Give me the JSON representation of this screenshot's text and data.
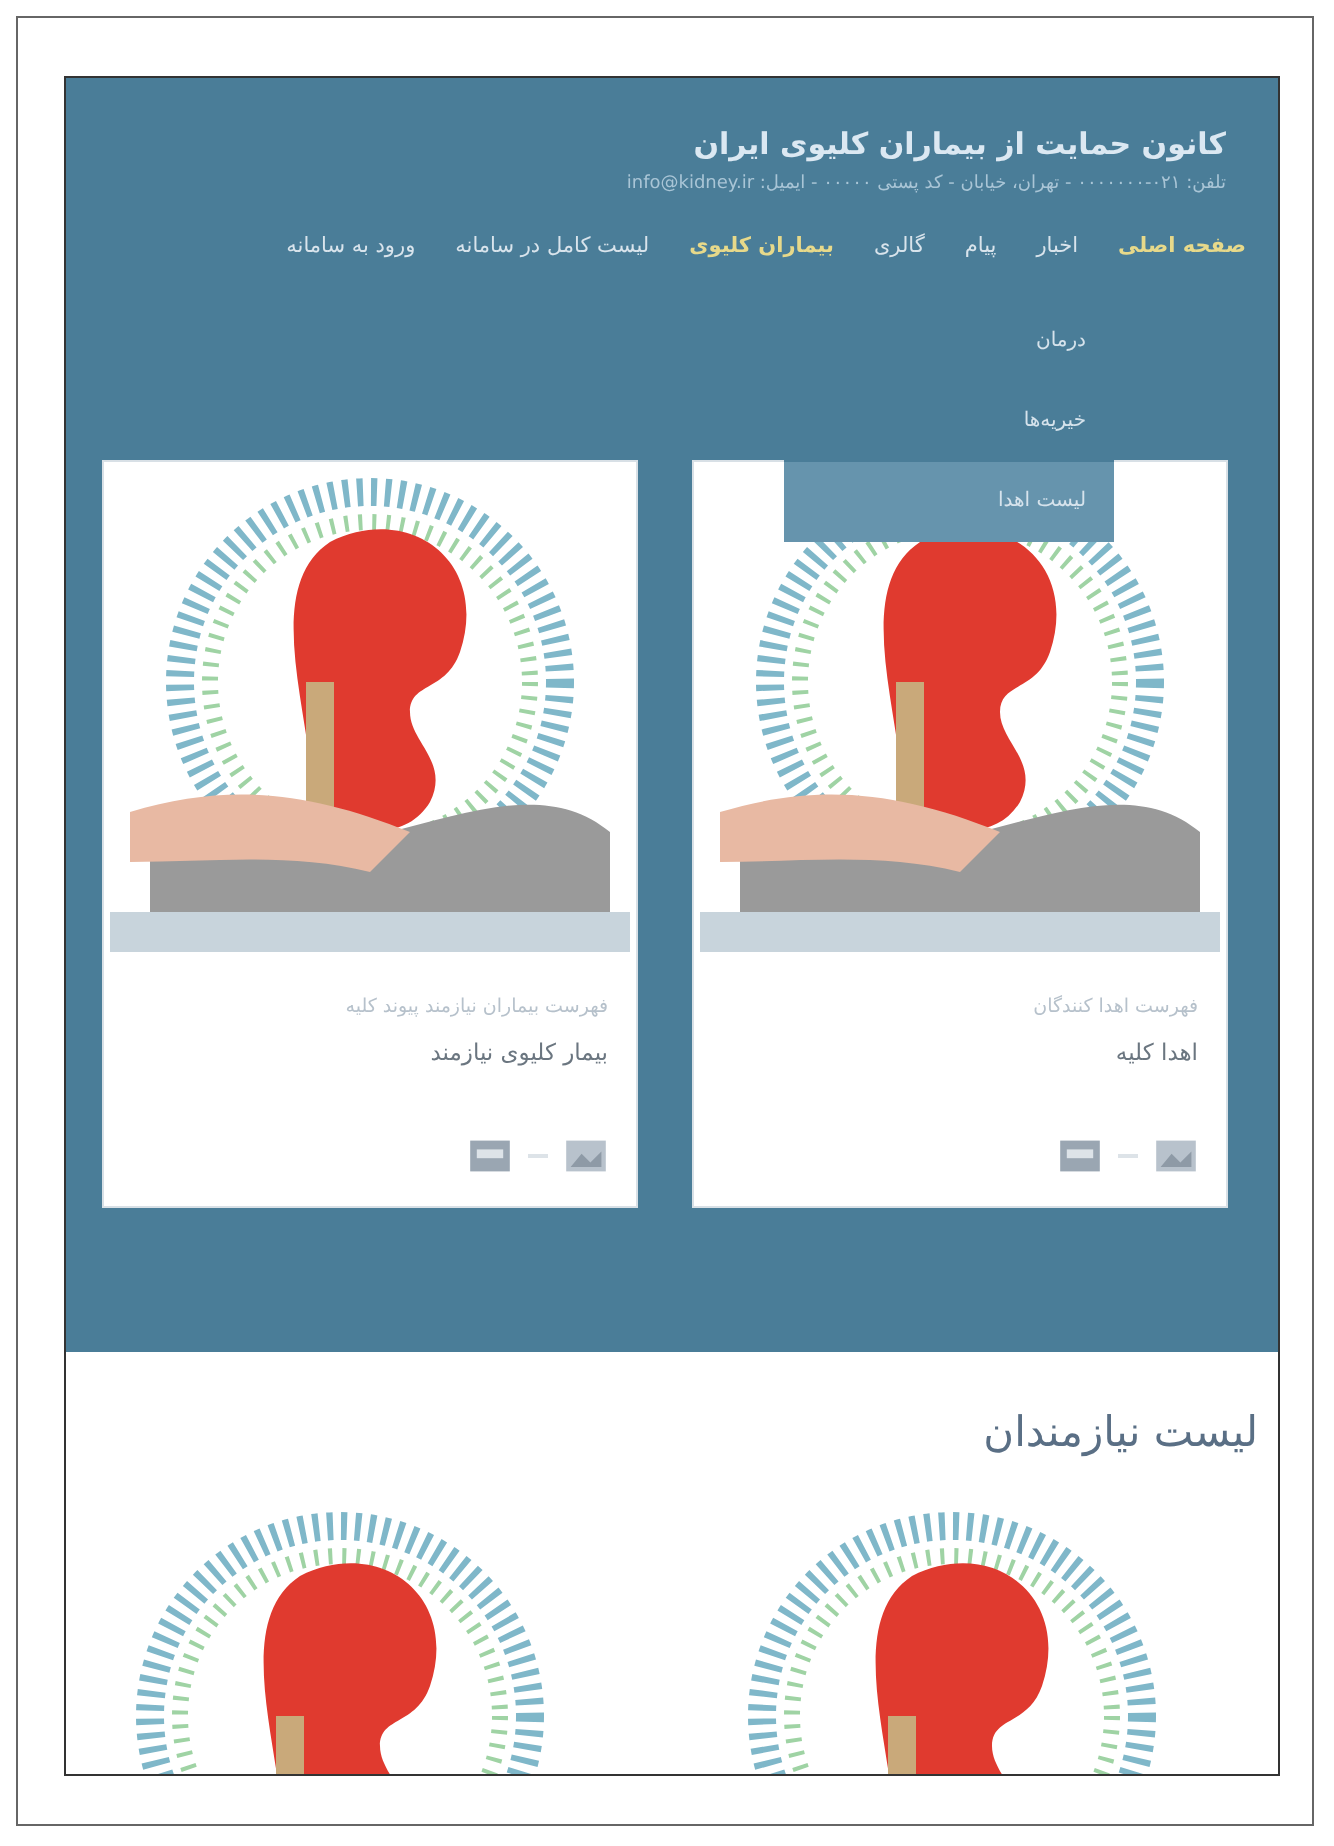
{
  "header": {
    "title": "کانون حمایت از بیماران کلیوی ایران",
    "subtitle": "تلفن: ۰۲۱-۰۰۰۰۰۰۰ - تهران، خیابان - کد پستی ۰۰۰۰۰ - ایمیل: info@kidney.ir"
  },
  "nav": [
    {
      "label": "صفحه اصلی",
      "highlighted": true
    },
    {
      "label": "اخبار",
      "highlighted": false
    },
    {
      "label": "پیام",
      "highlighted": false
    },
    {
      "label": "گالری",
      "highlighted": false
    },
    {
      "label": "بیماران کلیوی",
      "highlighted": true
    },
    {
      "label": "لیست کامل در سامانه",
      "highlighted": false
    },
    {
      "label": "ورود به سامانه",
      "highlighted": false
    }
  ],
  "dropdown": [
    {
      "label": "درمان",
      "selected": false
    },
    {
      "label": "خیریه‌ها",
      "selected": false
    },
    {
      "label": "لیست اهدا",
      "selected": true
    }
  ],
  "cards": [
    {
      "category": "فهرست اهدا کنندگان",
      "title": "اهدا کلیه"
    },
    {
      "category": "فهرست بیماران نیازمند پیوند کلیه",
      "title": "بیمار کلیوی نیازمند"
    }
  ],
  "section": {
    "heading": "لیست نیازمندان",
    "images": [
      {
        "kind": "kidney"
      },
      {
        "kind": "kidney"
      }
    ]
  }
}
